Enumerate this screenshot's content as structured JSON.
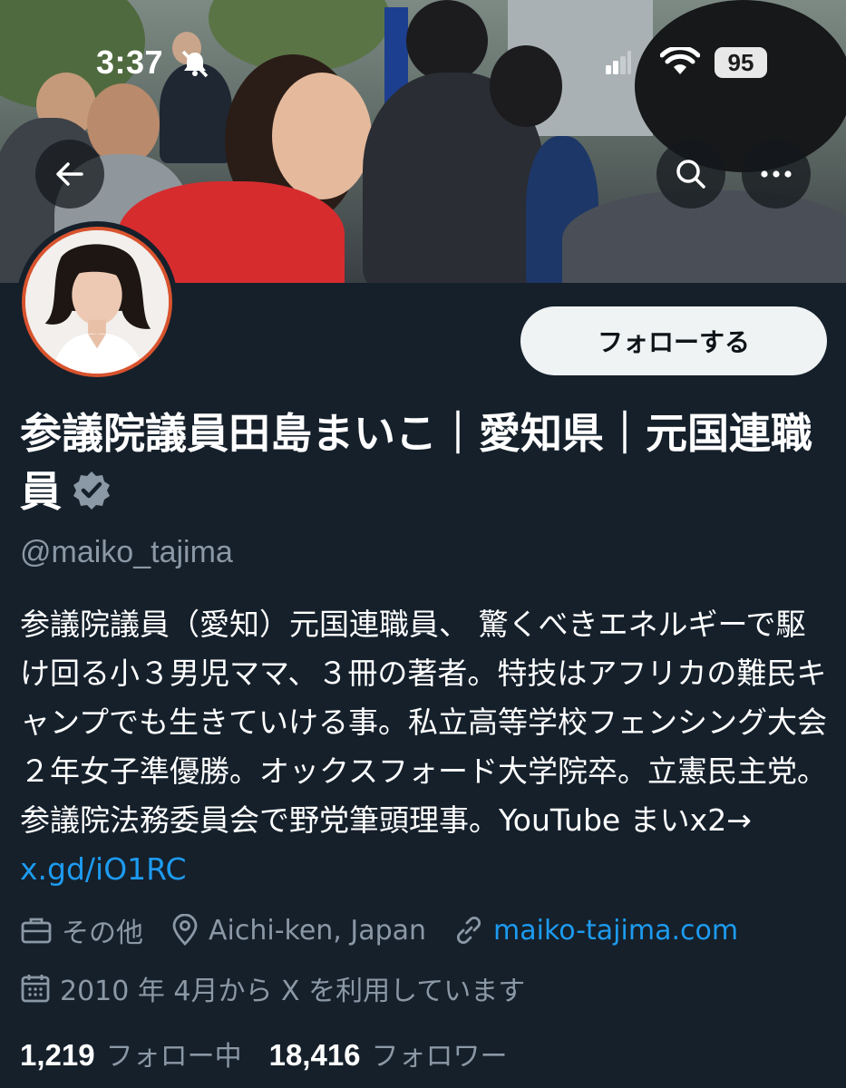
{
  "status_bar": {
    "time": "3:37",
    "battery": "95"
  },
  "header": {
    "back_icon": "arrow-left-icon",
    "search_icon": "search-icon",
    "more_icon": "more-horizontal-icon"
  },
  "profile": {
    "follow_label": "フォローする",
    "name": "参議院議員田島まいこ｜愛知県｜元国連職員",
    "handle": "@maiko_tajima",
    "bio_text": "参議院議員（愛知）元国連職員、 驚くべきエネルギーで駆け回る小３男児ママ、３冊の著者。特技はアフリカの難民キャンプでも生きていける事。私立高等学校フェンシング大会２年女子準優勝。オックスフォード大学院卒。立憲民主党。参議院法務委員会で野党筆頭理事。YouTube まいx2→ ",
    "bio_link": "x.gd/iO1RC",
    "category": "その他",
    "location": "Aichi-ken, Japan",
    "website": "maiko-tajima.com",
    "joined": "2010 年 4月から X を利用しています",
    "following_count": "1,219",
    "following_label": "フォロー中",
    "followers_count": "18,416",
    "followers_label": "フォロワー"
  },
  "colors": {
    "background": "#15202b",
    "muted_text": "#8b98a5",
    "link": "#1d9bf0",
    "avatar_ring": "#d8532e"
  }
}
